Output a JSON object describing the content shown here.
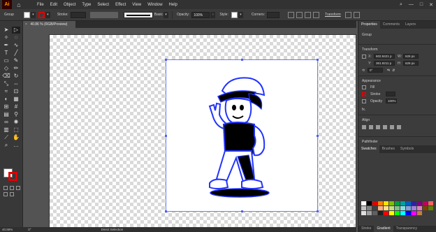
{
  "app": {
    "logo_text": "Ai"
  },
  "menu": [
    "File",
    "Edit",
    "Object",
    "Type",
    "Select",
    "Effect",
    "View",
    "Window",
    "Help"
  ],
  "control_bar": {
    "group_label": "Group",
    "stroke_label": "Stroke:",
    "brush_label": "Basic",
    "opacity_label": "Opacity:",
    "opacity_value": "100%",
    "style_label": "Style:",
    "corners_label": "Corners:",
    "transform_label": "Transform"
  },
  "document_tab": {
    "title": "40.86 % (RGB/Preview)",
    "close": "×"
  },
  "status_bar": {
    "zoom": "40.86%",
    "angle": "0°",
    "tool": "Direct Selection"
  },
  "panel": {
    "tabs": [
      "Properties",
      "Comments",
      "Layers"
    ],
    "group_title": "Group",
    "transform_title": "Transform",
    "x_label": "X:",
    "x_value": "602.8421 p",
    "y_label": "Y:",
    "y_value": "361.9211 p",
    "w_label": "W:",
    "w_value": "626 px",
    "h_label": "H:",
    "h_value": "626 px",
    "rotate_value": "0°",
    "appearance_title": "Appearance",
    "fill_label": "Fill",
    "stroke_label": "Stroke",
    "opacity_label": "Opacity",
    "opacity_value": "100%",
    "fx_label": "fx.",
    "align_title": "Align",
    "pathfinder_title": "Pathfinder",
    "swatch_tabs": [
      "Swatches",
      "Brushes",
      "Symbols"
    ],
    "bottom_tabs": [
      "Stroke",
      "Gradient",
      "Transparency"
    ]
  },
  "colors": {
    "accent_red": "#e00000",
    "selection_blue": "#4a62ff",
    "artwork_blue": "#2233ff",
    "swatches": [
      "#ffffff",
      "#000000",
      "#e00000",
      "#ff8000",
      "#ffe000",
      "#7fbf00",
      "#00a040",
      "#00a0a0",
      "#0060c0",
      "#3020a0",
      "#800080",
      "#c00060",
      "#ff6060",
      "#c0c0c0",
      "#808080",
      "#404040",
      "#ffb080",
      "#ffe080",
      "#c0e080",
      "#80c080",
      "#80e0e0",
      "#80a0e0",
      "#a080e0",
      "#e080c0",
      "#804000",
      "#608000",
      "#e0e0e0",
      "#a0a0a0",
      "#606060",
      "#202020",
      "#ff0000",
      "#ffff00",
      "#00ff00",
      "#00ffff",
      "#0000ff",
      "#ff00ff",
      "#c08040"
    ]
  }
}
